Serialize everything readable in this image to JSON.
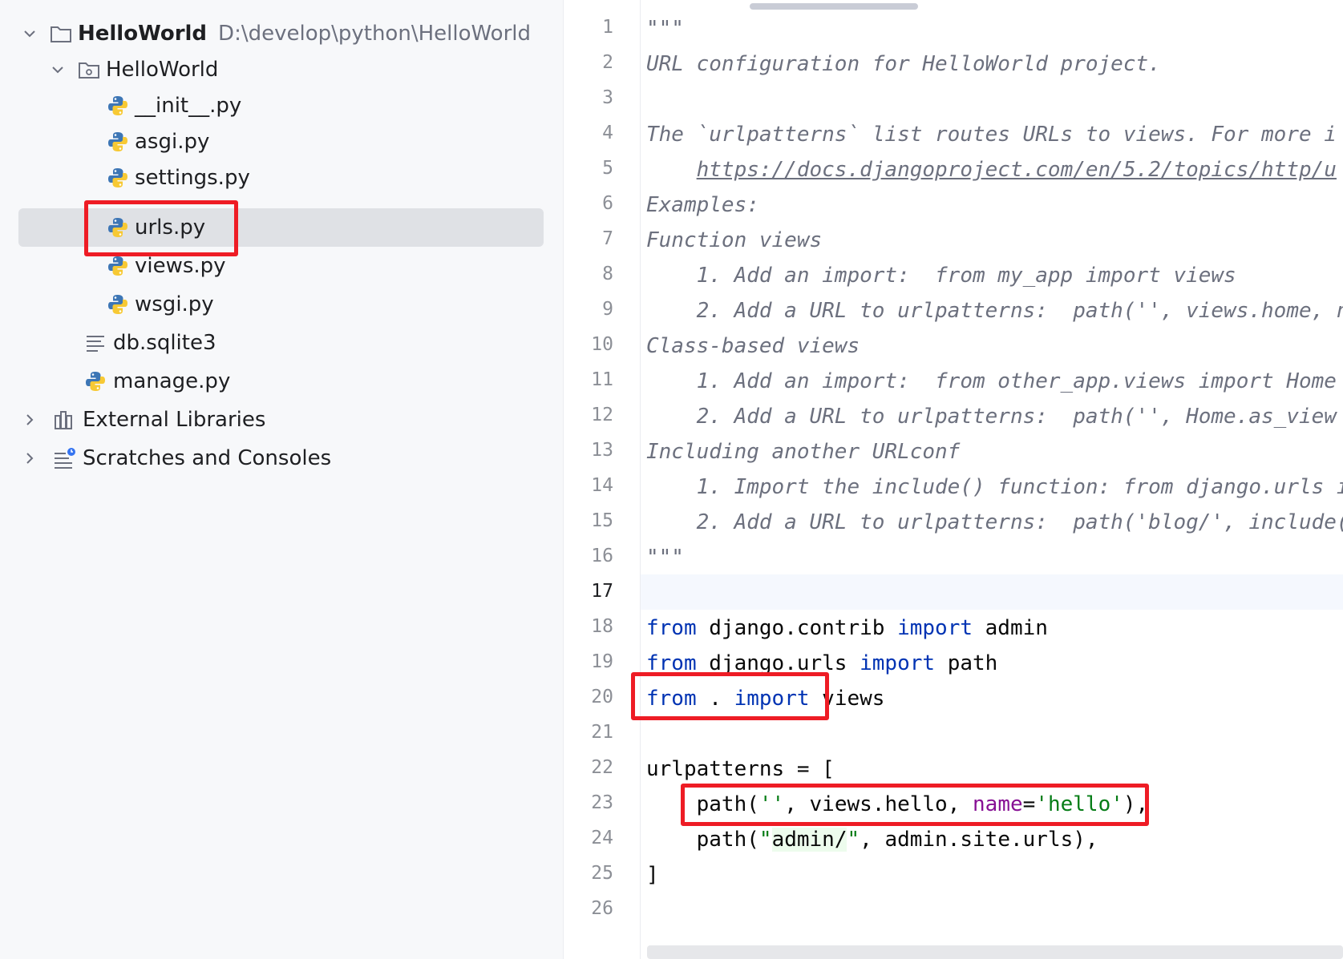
{
  "project_tree": {
    "root": {
      "name": "HelloWorld",
      "path": "D:\\develop\\python\\HelloWorld",
      "icon": "folder-icon",
      "expanded": true
    },
    "package": {
      "name": "HelloWorld",
      "icon": "package-folder-icon",
      "expanded": true
    },
    "package_files": [
      {
        "name": "__init__.py",
        "icon": "python-file-icon"
      },
      {
        "name": "asgi.py",
        "icon": "python-file-icon"
      },
      {
        "name": "settings.py",
        "icon": "python-file-icon"
      },
      {
        "name": "urls.py",
        "icon": "python-file-icon",
        "selected": true
      },
      {
        "name": "views.py",
        "icon": "python-file-icon"
      },
      {
        "name": "wsgi.py",
        "icon": "python-file-icon"
      }
    ],
    "root_files": [
      {
        "name": "db.sqlite3",
        "icon": "text-file-icon"
      },
      {
        "name": "manage.py",
        "icon": "python-file-icon"
      }
    ],
    "external_libraries": {
      "name": "External Libraries",
      "icon": "library-icon",
      "expanded": false
    },
    "scratches": {
      "name": "Scratches and Consoles",
      "icon": "scratches-icon",
      "expanded": false
    }
  },
  "editor": {
    "current_line": 17,
    "line_numbers": [
      "1",
      "2",
      "3",
      "4",
      "5",
      "6",
      "7",
      "8",
      "9",
      "10",
      "11",
      "12",
      "13",
      "14",
      "15",
      "16",
      "17",
      "18",
      "19",
      "20",
      "21",
      "22",
      "23",
      "24",
      "25",
      "26"
    ],
    "code": {
      "l1": "\"\"\"",
      "l2": "URL configuration for HelloWorld project.",
      "l4": "The `urlpatterns` list routes URLs to views. For more i",
      "l5_indent": "    ",
      "l5_link": "https://docs.djangoproject.com/en/5.2/topics/http/u",
      "l6": "Examples:",
      "l7": "Function views",
      "l8": "    1. Add an import:  from my_app import views",
      "l9": "    2. Add a URL to urlpatterns:  path('', views.home, n",
      "l10": "Class-based views",
      "l11": "    1. Add an import:  from other_app.views import Home",
      "l12": "    2. Add a URL to urlpatterns:  path('', Home.as_view",
      "l13": "Including another URLconf",
      "l14": "    1. Import the include() function: from django.urls i",
      "l15": "    2. Add a URL to urlpatterns:  path('blog/', include(",
      "l16": "\"\"\"",
      "l18": {
        "kw1": "from",
        "mod": " django.contrib ",
        "kw2": "import",
        "name": " admin"
      },
      "l19": {
        "kw1": "from",
        "mod": " django.urls ",
        "kw2": "import",
        "name": " path"
      },
      "l20": {
        "kw1": "from",
        "mod": " . ",
        "kw2": "import",
        "name": " views"
      },
      "l22": "urlpatterns = [",
      "l23": {
        "indent": "    ",
        "fn": "path(",
        "str1": "''",
        "mid": ", views.hello, ",
        "kwarg": "name",
        "eq": "=",
        "str2": "'hello'",
        "close": ")",
        "comma": ","
      },
      "l24": {
        "indent": "    ",
        "fn": "path(",
        "q1": "\"",
        "s": "admin/",
        "q2": "\"",
        "rest": ", admin.site.urls),"
      },
      "l25": "]"
    }
  },
  "colors": {
    "highlight_box": "#ee1c25",
    "keyword": "#0033b3",
    "string": "#067d17",
    "kwarg": "#871094",
    "docstring": "#6c707e",
    "selection": "#dfe1e5"
  }
}
